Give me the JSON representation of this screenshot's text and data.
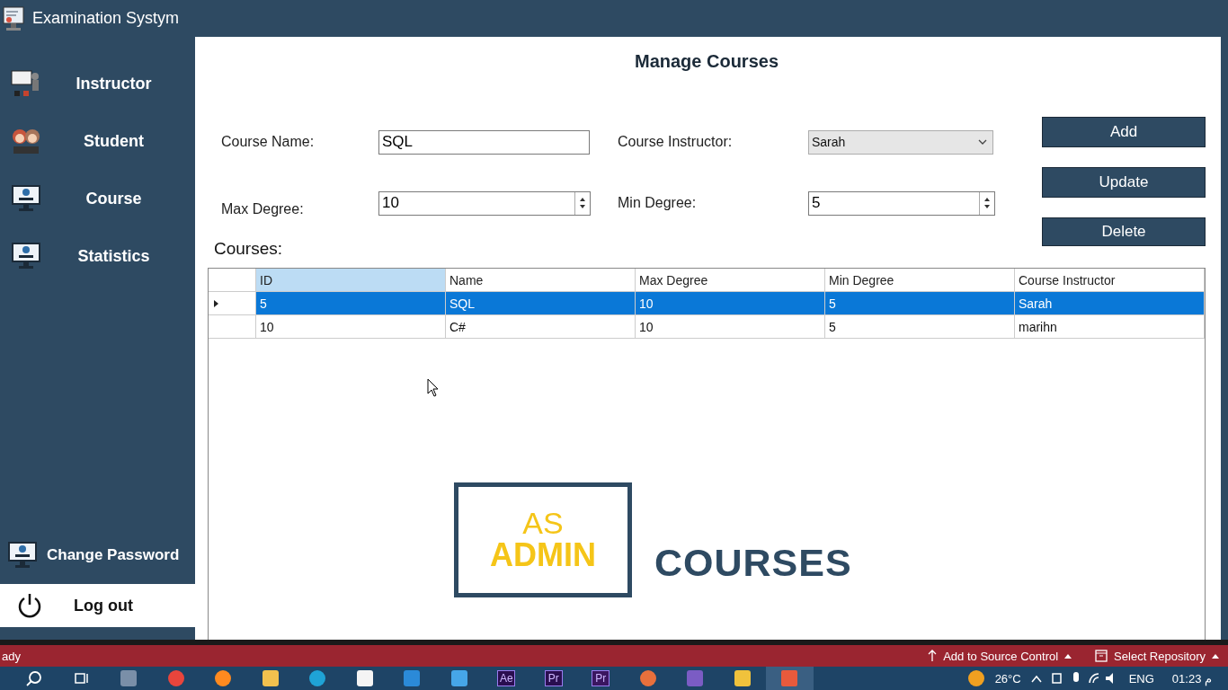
{
  "window": {
    "title": "Examination Systym"
  },
  "sidebar": {
    "items": [
      {
        "label": "Instructor",
        "kind": "instructor"
      },
      {
        "label": "Student",
        "kind": "student"
      },
      {
        "label": "Course",
        "kind": "monitor"
      },
      {
        "label": "Statistics",
        "kind": "monitor"
      }
    ],
    "change_password": "Change Password",
    "logout": "Log out"
  },
  "page": {
    "title": "Manage Courses",
    "course_name": {
      "label": "Course Name:",
      "value": "SQL"
    },
    "course_instructor": {
      "label": "Course Instructor:",
      "value": "Sarah"
    },
    "max_degree": {
      "label": "Max Degree:",
      "value": "10"
    },
    "min_degree": {
      "label": "Min Degree:",
      "value": "5"
    },
    "buttons": [
      "Add",
      "Update",
      "Delete"
    ],
    "list_label": "Courses:"
  },
  "table": {
    "columns": [
      {
        "label": "ID",
        "selected": true
      },
      {
        "label": "Name",
        "selected": false
      },
      {
        "label": "Max Degree",
        "selected": false
      },
      {
        "label": "Min Degree",
        "selected": false
      },
      {
        "label": "Course Instructor",
        "selected": false
      }
    ],
    "rows": [
      {
        "cells": [
          "5",
          "SQL",
          "10",
          "5",
          "Sarah"
        ],
        "selected": true
      },
      {
        "cells": [
          "10",
          "C#",
          "10",
          "5",
          "marihn"
        ],
        "selected": false
      }
    ]
  },
  "overlay": {
    "small": "AS",
    "big": "ADMIN",
    "side": "COURSES"
  },
  "status_bar": {
    "left": "ady",
    "source_control": "Add to Source Control",
    "repository": "Select Repository"
  },
  "taskbar": {
    "apps": [
      {
        "kind": "search"
      },
      {
        "kind": "taskview"
      },
      {
        "kind": "tile",
        "color": "#7a8fa8"
      },
      {
        "kind": "circle",
        "color": "#e8453c"
      },
      {
        "kind": "circle",
        "color": "#ff8a1f"
      },
      {
        "kind": "tile",
        "color": "#f2c14e"
      },
      {
        "kind": "circle",
        "color": "#1fa3d6"
      },
      {
        "kind": "tile",
        "color": "#f4f4f4"
      },
      {
        "kind": "tile",
        "color": "#2b8ad8"
      },
      {
        "kind": "tile",
        "color": "#46a6e8"
      },
      {
        "kind": "badge",
        "color": "#2a0e50",
        "label": "Ae"
      },
      {
        "kind": "badge",
        "color": "#2a0e50",
        "label": "Pr"
      },
      {
        "kind": "badge",
        "color": "#3a1660",
        "label": "Pr"
      },
      {
        "kind": "circle",
        "color": "#e8703c"
      },
      {
        "kind": "tile",
        "color": "#7b5cc4"
      },
      {
        "kind": "tile",
        "color": "#f0c23c"
      },
      {
        "kind": "active",
        "color": "#e85a3c"
      }
    ],
    "temperature": "26°C",
    "language": "ENG",
    "time": "01:23 م"
  }
}
